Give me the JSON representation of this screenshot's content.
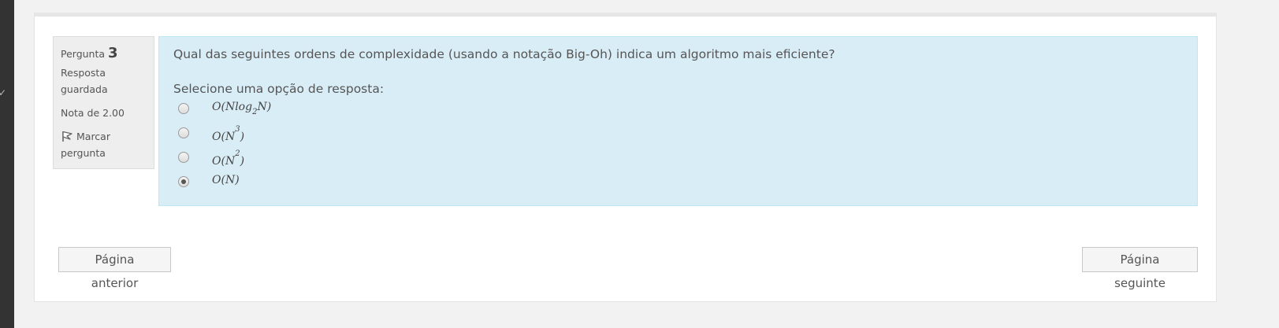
{
  "question": {
    "label": "Pergunta",
    "number": "3",
    "state": "Resposta guardada",
    "grade": "Nota de 2.00",
    "flag_label": "Marcar pergunta",
    "text": "Qual das seguintes ordens de complexidade (usando a notação Big-Oh) indica um algoritmo mais eficiente?",
    "prompt": "Selecione uma opção de resposta:",
    "options": [
      {
        "pre": "O(Nlog",
        "sub": "2",
        "post": "N)",
        "selected": false
      },
      {
        "pre": "O(N",
        "sup": "3",
        "post": ")",
        "selected": false
      },
      {
        "pre": "O(N",
        "sup": "2",
        "post": ")",
        "selected": false
      },
      {
        "pre": "O(N)",
        "selected": true
      }
    ]
  },
  "nav": {
    "prev_label": "Página anterior",
    "next_label": "Página seguinte"
  },
  "colors": {
    "panel_bg": "#d9edf7",
    "panel_border": "#bce8f1",
    "info_bg": "#eeeeee",
    "page_bg": "#f2f2f2",
    "left_strip": "#333333"
  },
  "icons": {
    "flag": "flag-icon"
  }
}
